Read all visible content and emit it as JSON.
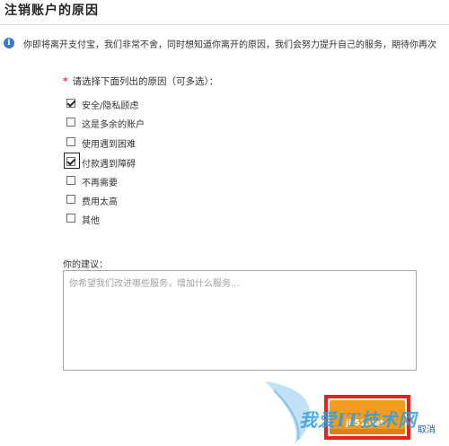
{
  "page": {
    "title": "注销账户的原因"
  },
  "notice": {
    "icon": "info-icon",
    "text": "你即将离开支付宝，我们非常不舍，同时想知道你离开的原因，我们会努力提升自己的服务，期待你再次"
  },
  "reasons": {
    "prompt": "请选择下面列出的原因（可多选）：",
    "required_mark": "*",
    "items": [
      {
        "label": "安全/隐私顾虑",
        "checked": true
      },
      {
        "label": "这是多余的账户",
        "checked": false
      },
      {
        "label": "使用遇到困难",
        "checked": false
      },
      {
        "label": "付款遇到障碍",
        "checked": true
      },
      {
        "label": "不再需要",
        "checked": false
      },
      {
        "label": "费用太高",
        "checked": false
      },
      {
        "label": "其他",
        "checked": false
      }
    ]
  },
  "suggestion": {
    "label": "你的建议：",
    "placeholder": "你希望我们改进哪些服务，增加什么服务..."
  },
  "actions": {
    "confirm_label": "jb51.net",
    "cancel_label": "取消"
  },
  "watermark": {
    "text": "我爱IT技术网"
  },
  "colors": {
    "accent_orange": "#f39b20",
    "highlight_red": "#e8221b",
    "link_blue": "#1d5fb0",
    "required_red": "#e23c3c"
  }
}
